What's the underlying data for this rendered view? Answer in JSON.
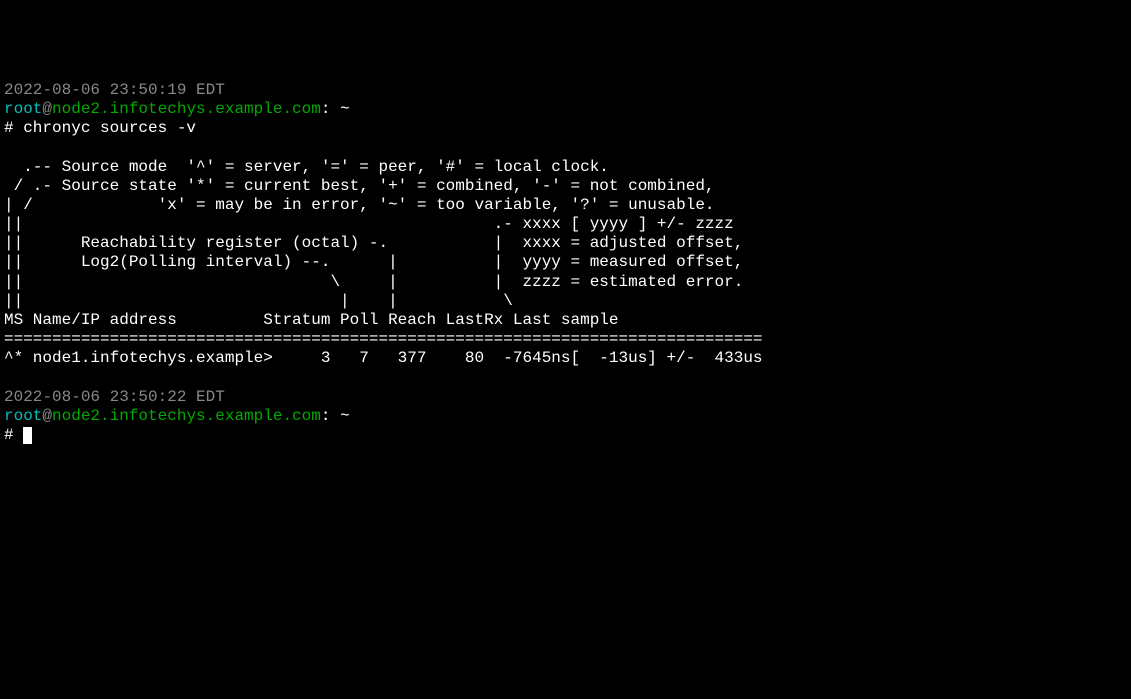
{
  "block1": {
    "timestamp": "2022-08-06 23:50:19 EDT",
    "user": "root",
    "at": "@",
    "host": "node2.infotechys.example.com",
    "path": ": ~",
    "prompt": "# ",
    "command": "chronyc sources -v"
  },
  "output": {
    "line1": "",
    "line2": "  .-- Source mode  '^' = server, '=' = peer, '#' = local clock.",
    "line3": " / .- Source state '*' = current best, '+' = combined, '-' = not combined,",
    "line4": "| /             'x' = may be in error, '~' = too variable, '?' = unusable.",
    "line5": "||                                                 .- xxxx [ yyyy ] +/- zzzz",
    "line6": "||      Reachability register (octal) -.           |  xxxx = adjusted offset,",
    "line7": "||      Log2(Polling interval) --.      |          |  yyyy = measured offset,",
    "line8": "||                                \\     |          |  zzzz = estimated error.",
    "line9": "||                                 |    |           \\",
    "header": "MS Name/IP address         Stratum Poll Reach LastRx Last sample",
    "divider": "===============================================================================",
    "dataRow": "^* node1.infotechys.example>     3   7   377    80  -7645ns[  -13us] +/-  433us"
  },
  "block2": {
    "timestamp": "2022-08-06 23:50:22 EDT",
    "user": "root",
    "at": "@",
    "host": "node2.infotechys.example.com",
    "path": ": ~",
    "prompt": "# "
  }
}
